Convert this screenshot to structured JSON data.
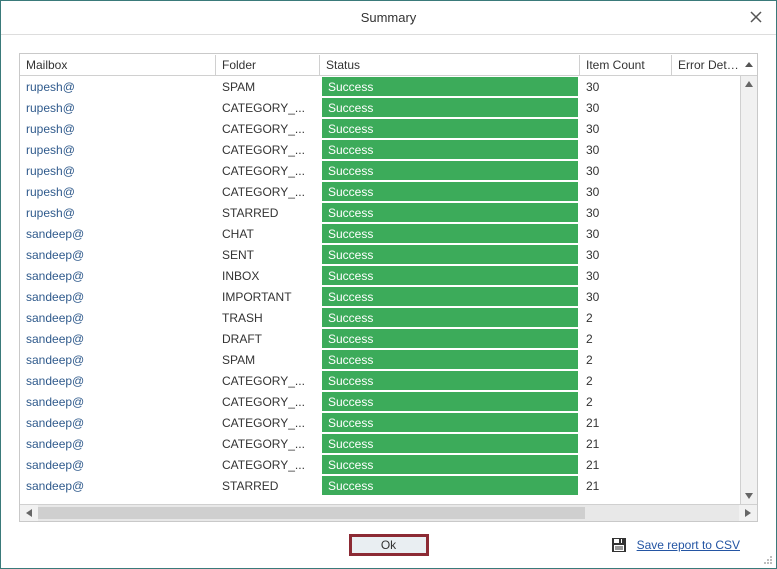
{
  "title": "Summary",
  "columns": {
    "mailbox": "Mailbox",
    "folder": "Folder",
    "status": "Status",
    "count": "Item Count",
    "error": "Error Details"
  },
  "rows": [
    {
      "mailbox": "rupesh@",
      "folder": "SPAM",
      "status": "Success",
      "count": "30",
      "error": ""
    },
    {
      "mailbox": "rupesh@",
      "folder": "CATEGORY_...",
      "status": "Success",
      "count": "30",
      "error": ""
    },
    {
      "mailbox": "rupesh@",
      "folder": "CATEGORY_...",
      "status": "Success",
      "count": "30",
      "error": ""
    },
    {
      "mailbox": "rupesh@",
      "folder": "CATEGORY_...",
      "status": "Success",
      "count": "30",
      "error": ""
    },
    {
      "mailbox": "rupesh@",
      "folder": "CATEGORY_...",
      "status": "Success",
      "count": "30",
      "error": ""
    },
    {
      "mailbox": "rupesh@",
      "folder": "CATEGORY_...",
      "status": "Success",
      "count": "30",
      "error": ""
    },
    {
      "mailbox": "rupesh@",
      "folder": "STARRED",
      "status": "Success",
      "count": "30",
      "error": ""
    },
    {
      "mailbox": "sandeep@",
      "folder": "CHAT",
      "status": "Success",
      "count": "30",
      "error": ""
    },
    {
      "mailbox": "sandeep@",
      "folder": "SENT",
      "status": "Success",
      "count": "30",
      "error": ""
    },
    {
      "mailbox": "sandeep@",
      "folder": "INBOX",
      "status": "Success",
      "count": "30",
      "error": ""
    },
    {
      "mailbox": "sandeep@",
      "folder": "IMPORTANT",
      "status": "Success",
      "count": "30",
      "error": ""
    },
    {
      "mailbox": "sandeep@",
      "folder": "TRASH",
      "status": "Success",
      "count": "2",
      "error": ""
    },
    {
      "mailbox": "sandeep@",
      "folder": "DRAFT",
      "status": "Success",
      "count": "2",
      "error": ""
    },
    {
      "mailbox": "sandeep@",
      "folder": "SPAM",
      "status": "Success",
      "count": "2",
      "error": ""
    },
    {
      "mailbox": "sandeep@",
      "folder": "CATEGORY_...",
      "status": "Success",
      "count": "2",
      "error": ""
    },
    {
      "mailbox": "sandeep@",
      "folder": "CATEGORY_...",
      "status": "Success",
      "count": "2",
      "error": ""
    },
    {
      "mailbox": "sandeep@",
      "folder": "CATEGORY_...",
      "status": "Success",
      "count": "21",
      "error": ""
    },
    {
      "mailbox": "sandeep@",
      "folder": "CATEGORY_...",
      "status": "Success",
      "count": "21",
      "error": ""
    },
    {
      "mailbox": "sandeep@",
      "folder": "CATEGORY_...",
      "status": "Success",
      "count": "21",
      "error": ""
    },
    {
      "mailbox": "sandeep@",
      "folder": "STARRED",
      "status": "Success",
      "count": "21",
      "error": ""
    }
  ],
  "buttons": {
    "ok": "Ok",
    "save": "Save report to CSV"
  }
}
